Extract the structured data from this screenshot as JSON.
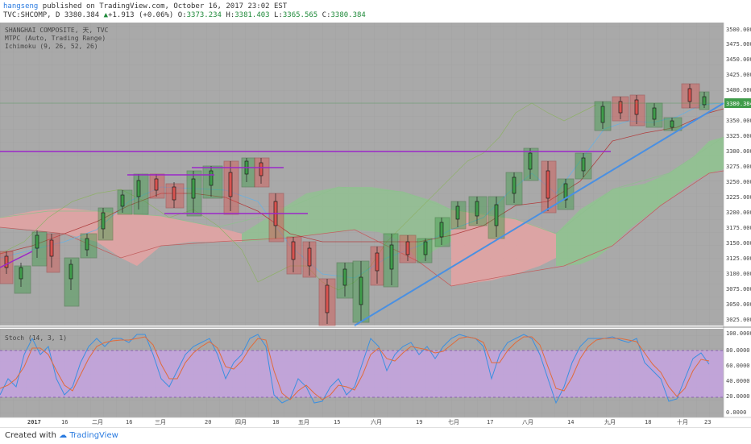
{
  "header": {
    "author": "hangseng",
    "published": " published on TradingView.com, October 16, 2017 23:02 EST",
    "symbol": "TVC:SHCOMP, D",
    "last": "3380.384",
    "change_arrow": "▲",
    "change": "+1.913 (+0.06%)",
    "o_label": "O:",
    "o": "3373.234",
    "h_label": "H:",
    "h": "3381.403",
    "l_label": "L:",
    "l": "3365.565",
    "c_label": "C:",
    "c": "3380.384"
  },
  "legend": {
    "line1": "SHANGHAI COMPOSITE, 天, TVC",
    "line2": "MTPC (Auto, Trading Range)",
    "line3": "Ichimoku (9, 26, 52, 26)",
    "stoch": "Stoch (14, 3, 1)"
  },
  "colors": {
    "bull": "#3f9c4a",
    "bear": "#d9534f",
    "cloud_bull": "#8fc48f",
    "cloud_bear": "#e8a3a3",
    "trendline": "#4a90e2",
    "resistance": "#9b27c9",
    "stoch_band": "#c9a3e8",
    "k_line": "#3b8fe0",
    "d_line": "#e06b3b"
  },
  "price_axis": {
    "ticks": [
      "3500.000",
      "3475.000",
      "3450.000",
      "3425.000",
      "3400.000",
      "3375.000",
      "3350.000",
      "3325.000",
      "3300.000",
      "3275.000",
      "3250.000",
      "3225.000",
      "3200.000",
      "3175.000",
      "3150.000",
      "3125.000",
      "3100.000",
      "3075.000",
      "3050.000",
      "3025.000"
    ],
    "last_badge": "3380.384"
  },
  "stoch_axis": {
    "ticks": [
      "100.0000",
      "80.0000",
      "60.0000",
      "40.0000",
      "20.0000",
      "0.0000"
    ]
  },
  "time_axis": {
    "labels": [
      "2017",
      "16",
      "二月",
      "16",
      "三月",
      "20",
      "四月",
      "18",
      "五月",
      "15",
      "六月",
      "19",
      "七月",
      "17",
      "八月",
      "14",
      "九月",
      "18",
      "十月",
      "23"
    ]
  },
  "footer": {
    "created": "Created with",
    "brand": "TradingView"
  }
}
